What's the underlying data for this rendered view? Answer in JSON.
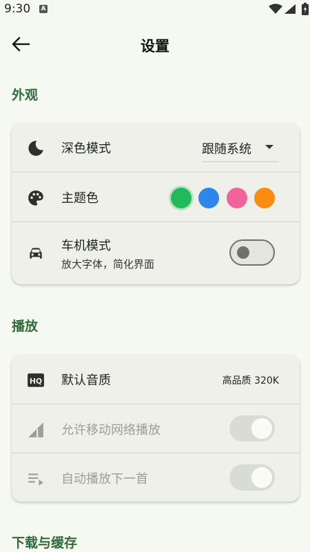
{
  "status_bar": {
    "time": "9:30",
    "notification_icon": "A"
  },
  "app_bar": {
    "title": "设置",
    "back_icon": "arrow-left-icon"
  },
  "sections": {
    "appearance": {
      "header": "外观",
      "dark_mode": {
        "icon": "moon-icon",
        "label": "深色模式",
        "value": "跟随系统"
      },
      "theme_color": {
        "icon": "palette-icon",
        "label": "主题色",
        "colors": [
          "#22b95a",
          "#2f86ea",
          "#f1639b",
          "#fb8c12"
        ],
        "selected_index": 0
      },
      "car_mode": {
        "icon": "car-icon",
        "label": "车机模式",
        "sublabel": "放大字体，简化界面",
        "enabled": false
      }
    },
    "playback": {
      "header": "播放",
      "default_quality": {
        "icon": "hq-icon",
        "label": "默认音质",
        "value": "高品质 320K"
      },
      "mobile_network": {
        "icon": "signal-icon",
        "label": "允许移动网络播放",
        "enabled": true,
        "disabled": true
      },
      "autoplay_next": {
        "icon": "playlist-play-icon",
        "label": "自动播放下一首",
        "enabled": true,
        "disabled": true
      }
    },
    "download": {
      "header": "下载与缓存"
    }
  }
}
